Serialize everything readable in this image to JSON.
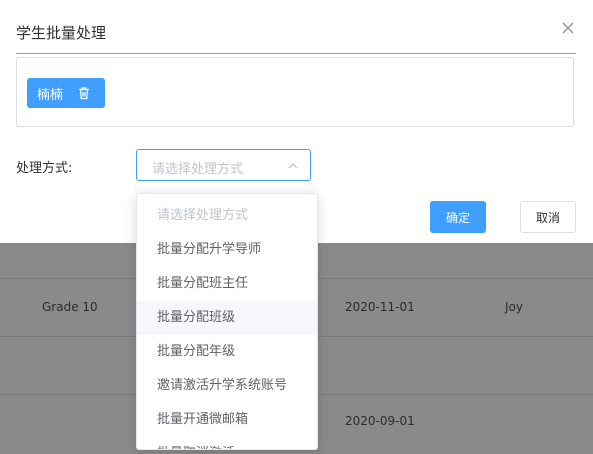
{
  "dialog": {
    "title": "学生批量处理",
    "student_tag": "楠楠",
    "method_label": "处理方式:",
    "select_placeholder": "请选择处理方式",
    "confirm_label": "确定",
    "cancel_label": "取消"
  },
  "dropdown": {
    "items": [
      "请选择处理方式",
      "批量分配升学导师",
      "批量分配班主任",
      "批量分配班级",
      "批量分配年级",
      "邀请激活升学系统账号",
      "批量开通微邮箱",
      "批量取消激活"
    ],
    "hovered_index": 3
  },
  "background_table": {
    "rows": [
      {
        "grade": "Grade 10",
        "date": "2020-11-01",
        "name": "Joy"
      },
      {
        "grade": "",
        "date": "2020-09-01",
        "name": ""
      }
    ]
  },
  "colors": {
    "primary": "#409eff",
    "overlay": "#7f7f7f"
  }
}
